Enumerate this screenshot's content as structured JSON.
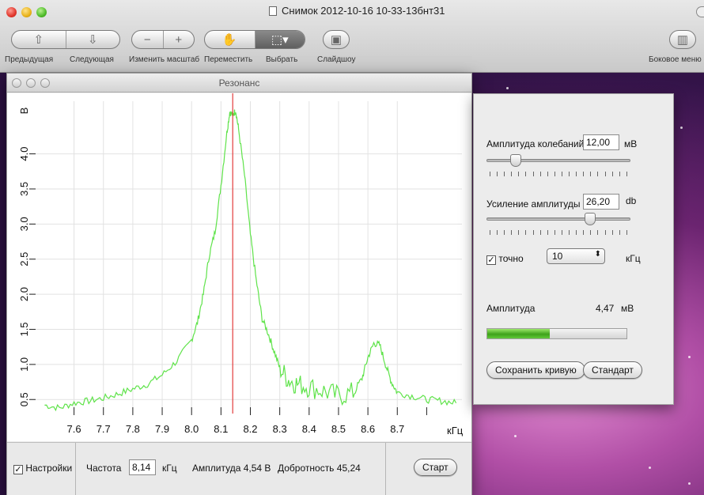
{
  "preview": {
    "title": "Снимок 2012-10-16 10-33-13бнт31",
    "toolbar": {
      "prev_label": "Предыдущая",
      "next_label": "Следующая",
      "zoom_label": "Изменить масштаб",
      "move_label": "Переместить",
      "select_label": "Выбрать",
      "slideshow_label": "Слайдшоу",
      "sidebar_label": "Боковое меню",
      "zoom_out_glyph": "−",
      "zoom_in_glyph": "+"
    }
  },
  "resonance": {
    "title": "Резонанс",
    "settings_label": "Настройки",
    "settings_checked": "✓",
    "frequency_label": "Частота",
    "frequency_value": "8,14",
    "frequency_unit": "кГц",
    "amplitude_text": "Амплитуда 4,54 В",
    "quality_text": "Добротность 45,24",
    "start_label": "Старт"
  },
  "controls": {
    "amplitude_label": "Амплитуда колебаний",
    "amplitude_value": "12,00",
    "amplitude_unit": "мВ",
    "amplitude_slider": 0.18,
    "gain_label": "Усиление амплитуды",
    "gain_value": "26,20",
    "gain_unit": "db",
    "gain_slider": 0.74,
    "exact_label": "точно",
    "exact_checked": "✓",
    "step_value": "10",
    "step_unit": "кГц",
    "measured_label": "Амплитуда",
    "measured_value": "4,47",
    "measured_unit": "мВ",
    "measured_progress": 0.45,
    "save_label": "Сохранить кривую",
    "default_label": "Стандарт"
  },
  "chart_data": {
    "type": "line",
    "x_unit_label": "кГц",
    "y_unit_label": "В",
    "xlim": [
      7.48,
      8.92
    ],
    "ylim": [
      0.3,
      4.75
    ],
    "x_ticks": [
      "7.6",
      "7.7",
      "7.8",
      "7.9",
      "8.0",
      "8.1",
      "8.2",
      "8.3",
      "8.4",
      "8.5",
      "8.6",
      "8.7"
    ],
    "y_ticks": [
      "0.5",
      "1.0",
      "1.5",
      "2.0",
      "2.5",
      "3.0",
      "3.5",
      "4.0"
    ],
    "marker_x": 8.14,
    "line_color": "#5fe34a",
    "marker_color": "#e23b3b",
    "series": [
      {
        "x": [
          7.5,
          7.55,
          7.6,
          7.65,
          7.7,
          7.75,
          7.8,
          7.85,
          7.9,
          7.95,
          8.0,
          8.02,
          8.04,
          8.06,
          8.08,
          8.1,
          8.12,
          8.13,
          8.14,
          8.15,
          8.16,
          8.18,
          8.2,
          8.22,
          8.24,
          8.26,
          8.28,
          8.3,
          8.33,
          8.36,
          8.4,
          8.45,
          8.5,
          8.55,
          8.58,
          8.6,
          8.62,
          8.64,
          8.66,
          8.68,
          8.7,
          8.75,
          8.8,
          8.85,
          8.9
        ],
        "y": [
          0.42,
          0.38,
          0.45,
          0.48,
          0.52,
          0.58,
          0.65,
          0.72,
          0.85,
          1.05,
          1.35,
          1.6,
          2.0,
          2.55,
          2.9,
          3.55,
          4.3,
          4.6,
          4.55,
          4.62,
          4.35,
          3.7,
          2.85,
          2.2,
          1.65,
          1.45,
          1.2,
          0.95,
          0.78,
          0.72,
          0.68,
          0.62,
          0.55,
          0.6,
          0.8,
          1.1,
          1.3,
          1.28,
          1.0,
          0.75,
          0.6,
          0.55,
          0.5,
          0.48,
          0.45
        ]
      }
    ]
  }
}
